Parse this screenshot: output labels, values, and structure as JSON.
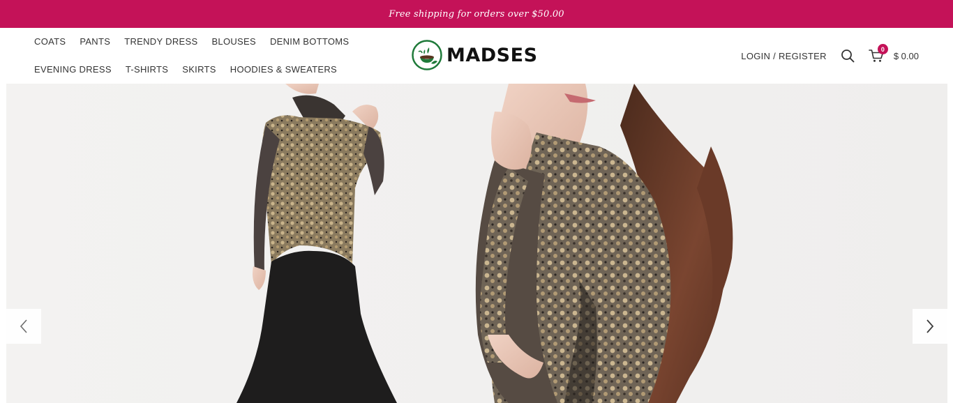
{
  "promo": {
    "text": "Free shipping for orders over $50.00"
  },
  "nav": {
    "row1": [
      "COATS",
      "PANTS",
      "TRENDY DRESS",
      "BLOUSES",
      "DENIM BOTTOMS"
    ],
    "row2": [
      "EVENING DRESS",
      "T-SHIRTS",
      "SKIRTS",
      "HOODIES & SWEATERS"
    ]
  },
  "logo": {
    "text": "MADSES"
  },
  "header": {
    "login_label": "LOGIN / REGISTER",
    "cart_count": "0",
    "cart_total": "$ 0.00"
  },
  "colors": {
    "brand": "#c41258",
    "logo_green": "#1f7a3a",
    "hero_bg": "#f1f0ef"
  },
  "icons": {
    "search": "search-icon",
    "cart": "cart-icon",
    "prev": "chevron-left-icon",
    "next": "chevron-right-icon"
  }
}
